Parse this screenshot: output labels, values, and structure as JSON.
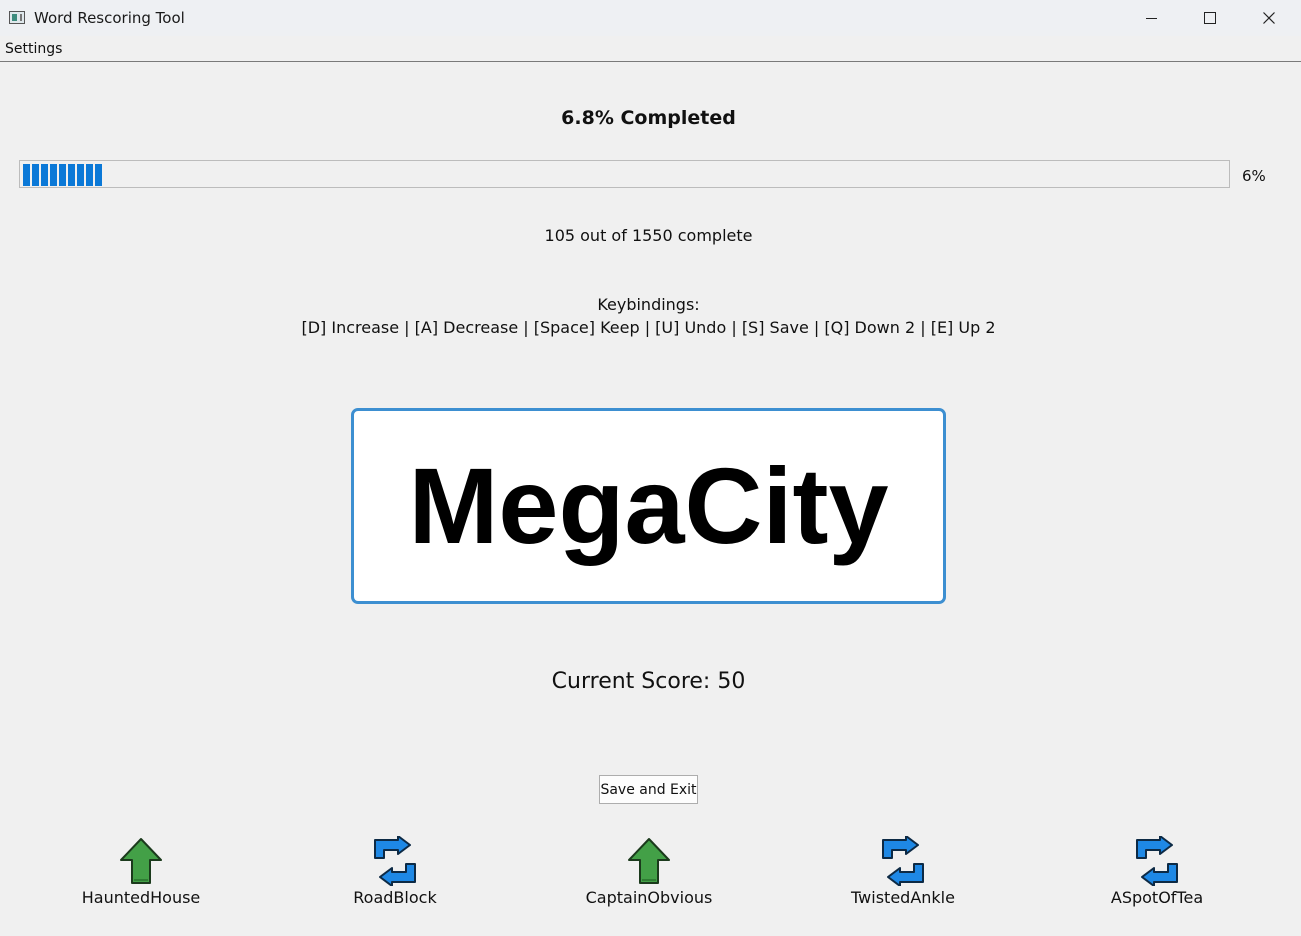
{
  "window": {
    "title": "Word Rescoring Tool"
  },
  "menu": {
    "settings": "Settings"
  },
  "progress": {
    "heading": "6.8% Completed",
    "bar_value": 0.068,
    "bar_text": "6%",
    "accent_color": "#0a78d7",
    "count_text": "105 out of 1550 complete"
  },
  "keybindings": {
    "title": "Keybindings:",
    "line": "[D] Increase | [A] Decrease | [Space] Keep | [U] Undo | [S] Save | [Q] Down 2 | [E] Up 2"
  },
  "current_word": "MegaCity",
  "score": {
    "text": "Current Score: 50"
  },
  "buttons": {
    "save_exit": "Save and Exit"
  },
  "history": [
    {
      "word": "HauntedHouse",
      "icon": "up-arrow-icon",
      "color": "#43a047"
    },
    {
      "word": "RoadBlock",
      "icon": "keep-cycle-icon",
      "color": "#1e88e5"
    },
    {
      "word": "CaptainObvious",
      "icon": "up-arrow-icon",
      "color": "#43a047"
    },
    {
      "word": "TwistedAnkle",
      "icon": "keep-cycle-icon",
      "color": "#1e88e5"
    },
    {
      "word": "ASpotOfTea",
      "icon": "keep-cycle-icon",
      "color": "#1e88e5"
    }
  ]
}
